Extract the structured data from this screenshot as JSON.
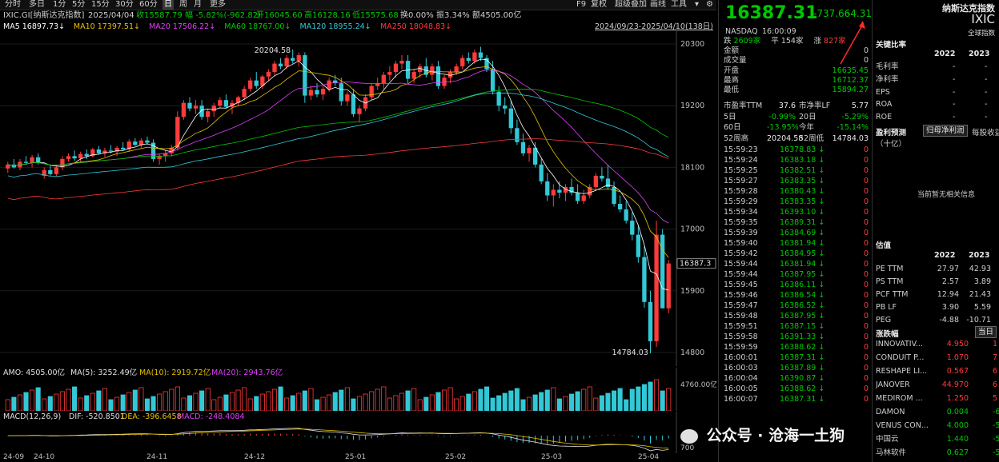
{
  "toolbar": {
    "items": [
      "分时",
      "多日",
      "1分",
      "5分",
      "15分",
      "30分",
      "60分",
      "日",
      "周",
      "月",
      "更多"
    ],
    "right_items": [
      "F9",
      "复权",
      "超级叠加",
      "画线",
      "工具"
    ]
  },
  "chart_info": {
    "symbol": "IXIC.GI[纳斯达克指数]",
    "date": "2025/04/04",
    "close": "收15587.79",
    "change": "幅 -5.82%(-962.82)",
    "open": "开16045.60",
    "high": "高16128.16",
    "low": "低15575.68",
    "turnover": "换0.00%",
    "amplitude": "振3.34%",
    "amount": "额4505.00亿",
    "ma_line": [
      {
        "label": "MA5",
        "value": "16897.73↓",
        "color": "#ffffff"
      },
      {
        "label": "MA10",
        "value": "17397.51↓",
        "color": "#e6c200"
      },
      {
        "label": "MA20",
        "value": "17506.22↓",
        "color": "#e040fb"
      },
      {
        "label": "MA60",
        "value": "18767.00↓",
        "color": "#00c800"
      },
      {
        "label": "MA120",
        "value": "18955.24↓",
        "color": "#33c8d6"
      },
      {
        "label": "MA250",
        "value": "18048.83↓",
        "color": "#ff3b3b"
      }
    ],
    "range": "2024/09/23-2025/04/10(138日)"
  },
  "chart_data": {
    "type": "candlestick",
    "y_ticks": [
      "20300",
      "19200",
      "18100",
      "17000",
      "15900",
      "14800"
    ],
    "ylim": [
      14700,
      20400
    ],
    "current_price_label": "16387.3",
    "high_marker": "20204.58",
    "low_marker": "14784.03",
    "x_ticks": [
      "24-09",
      "24-10",
      "24-11",
      "24-12",
      "25-01",
      "25-02",
      "25-03",
      "25-04"
    ],
    "candles": [
      [
        18080,
        18200,
        18000,
        18150
      ],
      [
        18150,
        18250,
        18080,
        18100
      ],
      [
        18100,
        18250,
        18050,
        18200
      ],
      [
        18200,
        18300,
        18150,
        18180
      ],
      [
        18180,
        18320,
        18100,
        18280
      ],
      [
        18280,
        18350,
        18150,
        18200
      ],
      [
        17950,
        18100,
        17900,
        18050
      ],
      [
        18050,
        18150,
        17950,
        17980
      ],
      [
        17980,
        18150,
        17950,
        18100
      ],
      [
        18100,
        18300,
        18050,
        18250
      ],
      [
        18250,
        18350,
        18200,
        18300
      ],
      [
        18300,
        18400,
        18220,
        18260
      ],
      [
        18260,
        18380,
        18200,
        18340
      ],
      [
        18340,
        18420,
        18250,
        18300
      ],
      [
        18300,
        18450,
        18280,
        18420
      ],
      [
        18420,
        18480,
        18330,
        18350
      ],
      [
        18350,
        18450,
        18290,
        18400
      ],
      [
        18400,
        18500,
        18350,
        18380
      ],
      [
        18380,
        18480,
        18300,
        18450
      ],
      [
        18450,
        18550,
        18400,
        18420
      ],
      [
        18420,
        18600,
        18380,
        18560
      ],
      [
        18560,
        18620,
        18480,
        18500
      ],
      [
        18500,
        18620,
        18450,
        18580
      ],
      [
        18580,
        18650,
        18500,
        18540
      ],
      [
        18540,
        18600,
        18200,
        18250
      ],
      [
        18250,
        18350,
        18150,
        18300
      ],
      [
        18300,
        18400,
        18200,
        18350
      ],
      [
        18350,
        18500,
        18300,
        18450
      ],
      [
        18450,
        19100,
        18400,
        19000
      ],
      [
        19000,
        19300,
        18950,
        19250
      ],
      [
        19250,
        19350,
        19100,
        19150
      ],
      [
        19150,
        19300,
        19050,
        19200
      ],
      [
        19200,
        19300,
        18950,
        19000
      ],
      [
        19000,
        19150,
        18900,
        19100
      ],
      [
        19100,
        19250,
        19000,
        19200
      ],
      [
        19200,
        19350,
        19150,
        19300
      ],
      [
        19300,
        19400,
        19150,
        19180
      ],
      [
        19180,
        19300,
        19050,
        19250
      ],
      [
        19250,
        19380,
        19200,
        19350
      ],
      [
        19350,
        19550,
        19300,
        19500
      ],
      [
        19500,
        19700,
        19450,
        19650
      ],
      [
        19650,
        19800,
        19500,
        19550
      ],
      [
        19550,
        19750,
        19500,
        19720
      ],
      [
        19720,
        19850,
        19650,
        19800
      ],
      [
        19800,
        20000,
        19750,
        19950
      ],
      [
        19950,
        20050,
        19850,
        19900
      ],
      [
        19900,
        20100,
        19850,
        20050
      ],
      [
        20050,
        20204,
        19950,
        20000
      ],
      [
        20000,
        20150,
        19900,
        20100
      ],
      [
        20100,
        20150,
        19250,
        19380
      ],
      [
        19380,
        19550,
        19300,
        19480
      ],
      [
        19480,
        19600,
        19350,
        19400
      ],
      [
        19400,
        19550,
        19300,
        19500
      ],
      [
        19500,
        19700,
        19450,
        19650
      ],
      [
        19650,
        19750,
        19550,
        19600
      ],
      [
        19600,
        19700,
        19200,
        19280
      ],
      [
        19280,
        19450,
        19200,
        19400
      ],
      [
        19400,
        19500,
        19000,
        19050
      ],
      [
        19050,
        19200,
        18900,
        19150
      ],
      [
        19150,
        19400,
        19100,
        19350
      ],
      [
        19350,
        19600,
        19300,
        19550
      ],
      [
        19550,
        19700,
        19480,
        19600
      ],
      [
        19600,
        19800,
        19500,
        19750
      ],
      [
        19750,
        19900,
        19650,
        19800
      ],
      [
        19800,
        20000,
        19700,
        19950
      ],
      [
        19950,
        20100,
        19850,
        20000
      ],
      [
        20000,
        20100,
        19600,
        19680
      ],
      [
        19680,
        19850,
        19600,
        19800
      ],
      [
        19800,
        19950,
        19700,
        19900
      ],
      [
        19900,
        20050,
        19700,
        19750
      ],
      [
        19750,
        19950,
        19650,
        19900
      ],
      [
        19900,
        20000,
        19500,
        19550
      ],
      [
        19550,
        19750,
        19500,
        19700
      ],
      [
        19700,
        19850,
        19600,
        19800
      ],
      [
        19800,
        19950,
        19750,
        19900
      ],
      [
        19900,
        20100,
        19850,
        20050
      ],
      [
        20050,
        20150,
        19950,
        20000
      ],
      [
        20000,
        20200,
        19950,
        20150
      ],
      [
        20150,
        20250,
        20000,
        20050
      ],
      [
        20050,
        20100,
        19800,
        19850
      ],
      [
        19850,
        20000,
        19400,
        19450
      ],
      [
        19450,
        19550,
        19100,
        19200
      ],
      [
        19200,
        19350,
        19050,
        19150
      ],
      [
        19150,
        19300,
        18700,
        18800
      ],
      [
        18800,
        18950,
        18500,
        18550
      ],
      [
        18550,
        18700,
        18300,
        18350
      ],
      [
        18350,
        18500,
        18200,
        18450
      ],
      [
        18450,
        18550,
        18100,
        18150
      ],
      [
        18150,
        18250,
        17800,
        17850
      ],
      [
        17850,
        18000,
        17500,
        17600
      ],
      [
        17600,
        17800,
        17400,
        17700
      ],
      [
        17700,
        17850,
        17550,
        17650
      ],
      [
        17650,
        17800,
        17500,
        17750
      ],
      [
        17750,
        17900,
        17600,
        17650
      ],
      [
        17650,
        17800,
        17450,
        17500
      ],
      [
        17500,
        17700,
        17450,
        17600
      ],
      [
        17600,
        17800,
        17550,
        17750
      ],
      [
        17750,
        18000,
        17700,
        17950
      ],
      [
        17950,
        18100,
        17850,
        17900
      ],
      [
        17900,
        18150,
        17700,
        17750
      ],
      [
        17750,
        17850,
        17400,
        17450
      ],
      [
        17450,
        17600,
        17300,
        17350
      ],
      [
        17350,
        17500,
        17100,
        17150
      ],
      [
        17150,
        17300,
        16800,
        16900
      ],
      [
        16900,
        17050,
        16400,
        16500
      ],
      [
        16500,
        16700,
        15600,
        15700
      ],
      [
        15700,
        15900,
        14784,
        15000
      ],
      [
        15000,
        17150,
        14900,
        16900
      ],
      [
        16900,
        17000,
        15650,
        15587
      ],
      [
        15587,
        16450,
        15500,
        16387
      ]
    ]
  },
  "volume": {
    "label_amo": "AMO: 4505.00亿",
    "label_ma5": "MA(5): 3252.49亿",
    "label_ma10": "MA(10): 2919.72亿",
    "label_ma20": "MA(20): 2943.76亿",
    "axis_label": "4760.00亿"
  },
  "macd": {
    "label": "MACD(12,26,9)",
    "dif": "DIF: -520.8501",
    "dea": "DEA: -396.6458",
    "macd": "MACD: -248.4084",
    "axis_label": "700"
  },
  "quote": {
    "price": "16387.31",
    "change": "-737.66",
    "change_pct": "-4.31%",
    "exchange": "NASDAQ",
    "time": "16:00:09",
    "breadth": {
      "down_label": "跌",
      "down": "2609家",
      "flat_label": "平",
      "flat": "154家",
      "up_label": "涨",
      "up": "827家"
    },
    "stats": [
      {
        "label": "金额",
        "value": "0"
      },
      {
        "label": "成交量",
        "value": "0"
      },
      {
        "label": "开盘",
        "value": "16635.45"
      },
      {
        "label": "最高",
        "value": "16712.37"
      },
      {
        "label": "最低",
        "value": "15894.27"
      }
    ],
    "ratios": [
      {
        "l1": "市盈率TTM",
        "v1": "37.6",
        "l2": "市净率LF",
        "v2": "5.77"
      },
      {
        "l1": "5日",
        "v1": "-0.99%",
        "l2": "20日",
        "v2": "-5.29%"
      },
      {
        "l1": "60日",
        "v1": "-13.95%",
        "l2": "今年",
        "v2": "-15.14%"
      },
      {
        "l1": "52周高",
        "v1": "20204.58",
        "l2": "52周低",
        "v2": "14784.03"
      }
    ],
    "ticks": [
      {
        "t": "15:59:23",
        "p": "16378.83",
        "v": "0"
      },
      {
        "t": "15:59:24",
        "p": "16383.18",
        "v": "0"
      },
      {
        "t": "15:59:25",
        "p": "16382.51",
        "v": "0"
      },
      {
        "t": "15:59:27",
        "p": "16383.35",
        "v": "0"
      },
      {
        "t": "15:59:28",
        "p": "16380.43",
        "v": "0"
      },
      {
        "t": "15:59:29",
        "p": "16383.35",
        "v": "0"
      },
      {
        "t": "15:59:34",
        "p": "16393.10",
        "v": "0"
      },
      {
        "t": "15:59:35",
        "p": "16389.31",
        "v": "0"
      },
      {
        "t": "15:59:39",
        "p": "16384.69",
        "v": "0"
      },
      {
        "t": "15:59:40",
        "p": "16381.94",
        "v": "0"
      },
      {
        "t": "15:59:42",
        "p": "16384.95",
        "v": "0"
      },
      {
        "t": "15:59:44",
        "p": "16381.94",
        "v": "0"
      },
      {
        "t": "15:59:44",
        "p": "16387.95",
        "v": "0"
      },
      {
        "t": "15:59:45",
        "p": "16386.11",
        "v": "0"
      },
      {
        "t": "15:59:46",
        "p": "16386.54",
        "v": "0"
      },
      {
        "t": "15:59:47",
        "p": "16386.52",
        "v": "0"
      },
      {
        "t": "15:59:48",
        "p": "16387.95",
        "v": "0"
      },
      {
        "t": "15:59:51",
        "p": "16387.15",
        "v": "0"
      },
      {
        "t": "15:59:58",
        "p": "16391.33",
        "v": "0"
      },
      {
        "t": "15:59:59",
        "p": "16388.62",
        "v": "0"
      },
      {
        "t": "16:00:01",
        "p": "16387.31",
        "v": "0"
      },
      {
        "t": "16:00:03",
        "p": "16387.89",
        "v": "0"
      },
      {
        "t": "16:00:04",
        "p": "16390.87",
        "v": "0"
      },
      {
        "t": "16:00:05",
        "p": "16388.62",
        "v": "0"
      },
      {
        "t": "16:00:07",
        "p": "16387.31",
        "v": "0"
      }
    ]
  },
  "fund": {
    "title": "纳斯达克指数",
    "code": "IXIC",
    "full_label": "全球指数",
    "key_ratio_title": "关键比率",
    "years": [
      "2022",
      "2023"
    ],
    "key_ratios": [
      {
        "label": "毛利率",
        "a": "-",
        "b": "-"
      },
      {
        "label": "净利率",
        "a": "-",
        "b": "-"
      },
      {
        "label": "EPS",
        "a": "-",
        "b": "-"
      },
      {
        "label": "ROA",
        "a": "-",
        "b": "-"
      },
      {
        "label": "ROE",
        "a": "-",
        "b": "-"
      }
    ],
    "forecast_title": "盈利预测",
    "forecast_unit": "（十亿）",
    "forecast_btn1": "归母净利润",
    "forecast_btn2": "每股收益",
    "forecast_empty": "当前暂无相关信息",
    "valuation_title": "估值",
    "valuation_years": [
      "2022",
      "2023"
    ],
    "valuation": [
      {
        "label": "PE TTM",
        "a": "27.97",
        "b": "42.93"
      },
      {
        "label": "PS TTM",
        "a": "2.57",
        "b": "3.89"
      },
      {
        "label": "PCF TTM",
        "a": "12.94",
        "b": "21.43"
      },
      {
        "label": "PB LF",
        "a": "3.90",
        "b": "5.59"
      },
      {
        "label": "PEG",
        "a": "-4.88",
        "b": "-10.71"
      }
    ],
    "movers_title": "涨跌幅",
    "movers_btn": "当日",
    "movers": [
      {
        "name": "INNOVATIV...",
        "v": "4.950",
        "pct": "1"
      },
      {
        "name": "CONDUIT P...",
        "v": "1.070",
        "pct": "7"
      },
      {
        "name": "RESHAPE LI...",
        "v": "0.567",
        "pct": "6"
      },
      {
        "name": "JANOVER",
        "v": "44.970",
        "pct": "6"
      },
      {
        "name": "MEDIROM ...",
        "v": "1.250",
        "pct": "5"
      },
      {
        "name": "DAMON",
        "v": "0.004",
        "pct": "-6"
      },
      {
        "name": "VENUS CON...",
        "v": "4.000",
        "pct": "-5"
      },
      {
        "name": "中国云",
        "v": "1.440",
        "pct": "-5"
      },
      {
        "name": "马林软件",
        "v": "0.627",
        "pct": "-5"
      }
    ]
  },
  "watermark": "公众号 · 沧海一土狗"
}
